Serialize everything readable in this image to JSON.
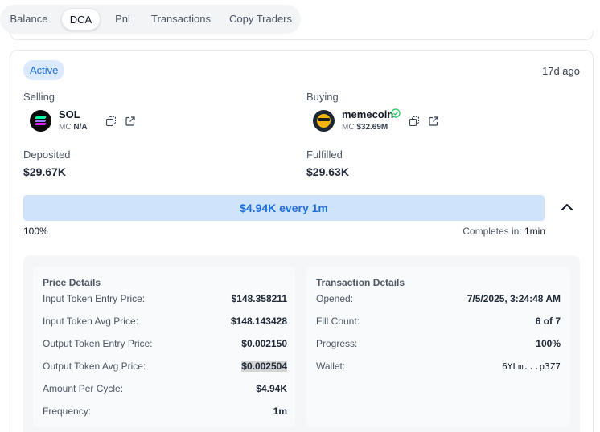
{
  "tabs": [
    {
      "label": "Balance"
    },
    {
      "label": "DCA"
    },
    {
      "label": "Pnl"
    },
    {
      "label": "Transactions"
    },
    {
      "label": "Copy Traders"
    }
  ],
  "active_tab": "DCA",
  "order": {
    "status": "Active",
    "time_ago": "17d ago",
    "selling": {
      "label": "Selling",
      "token": "SOL",
      "mc_prefix": "MC",
      "mc_value": "N/A",
      "icon": "solana-logo"
    },
    "buying": {
      "label": "Buying",
      "token": "memecoin",
      "mc_prefix": "MC",
      "mc_value": "$32.69M",
      "verified": true,
      "icon": "memecoin-logo"
    },
    "deposited": {
      "label": "Deposited",
      "value": "$29.67K"
    },
    "fulfilled": {
      "label": "Fulfilled",
      "value": "$29.63K"
    },
    "progress": {
      "text": "$4.94K every 1m",
      "percent_label": "100%",
      "fill_fraction": 1.0,
      "completes_label": "Completes in:",
      "completes_value": "1min"
    }
  },
  "price_details": {
    "title": "Price Details",
    "rows": [
      {
        "label": "Input Token Entry Price:",
        "value": "$148.358211"
      },
      {
        "label": "Input Token Avg Price:",
        "value": "$148.143428"
      },
      {
        "label": "Output Token Entry Price:",
        "value": "$0.002150"
      },
      {
        "label": "Output Token Avg Price:",
        "value": "$0.002504"
      },
      {
        "label": "Amount Per Cycle:",
        "value": "$4.94K"
      },
      {
        "label": "Frequency:",
        "value": "1m"
      }
    ]
  },
  "transaction_details": {
    "title": "Transaction Details",
    "rows": [
      {
        "label": "Opened:",
        "value": "7/5/2025, 3:24:48 AM"
      },
      {
        "label": "Fill Count:",
        "value": "6 of 7"
      },
      {
        "label": "Progress:",
        "value": "100%"
      },
      {
        "label": "Wallet:",
        "value": "6YLm...p3Z7"
      }
    ]
  },
  "colors": {
    "accent": "#1e6fd9",
    "progress_fill": "#cfe3fb",
    "badge_bg": "#dbeafe",
    "verified": "#22c55e"
  }
}
